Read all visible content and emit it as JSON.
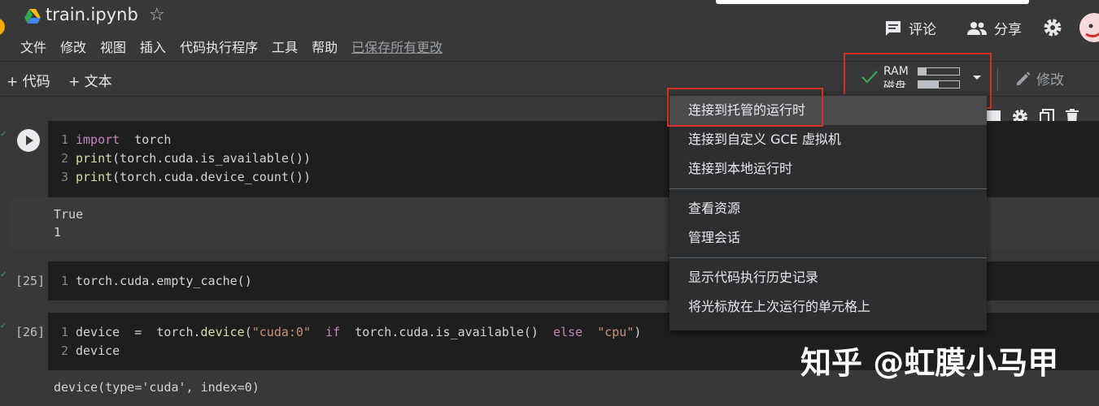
{
  "header": {
    "title": "train.ipynb",
    "menu": [
      "文件",
      "修改",
      "视图",
      "插入",
      "代码执行程序",
      "工具",
      "帮助"
    ],
    "saved_status": "已保存所有更改",
    "comment_label": "评论",
    "share_label": "分享"
  },
  "toolbar": {
    "add_code": "+ 代码",
    "add_text": "+ 文本",
    "ram_label": "RAM",
    "disk_label": "磁盘",
    "ram_usage": 0.2,
    "disk_usage": 0.5,
    "edit_label": "修改"
  },
  "cells": [
    {
      "exec_count": "",
      "lines": [
        {
          "n": "1",
          "a": "import",
          "b": "  torch"
        },
        {
          "n": "2",
          "a": "print",
          "b": "(torch.cuda.is_available())"
        },
        {
          "n": "3",
          "a": "print",
          "b": "(torch.cuda.device_count())"
        }
      ],
      "output": [
        "True",
        "1"
      ]
    },
    {
      "exec_count": "[25]",
      "lines": [
        {
          "n": "1",
          "text": "torch.cuda.empty_cache()"
        }
      ]
    },
    {
      "exec_count": "[26]",
      "line1": {
        "n": "1",
        "p1": "device",
        "p2": "  =  torch.",
        "p3": "device",
        "p4": "(",
        "p5": "\"cuda:0\"",
        "p6": "  if  ",
        "p7": "torch.cuda.is_available()",
        "p8": "  else  ",
        "p9": "\"cpu\"",
        "p10": ")"
      },
      "line2": {
        "n": "2",
        "text": "device"
      },
      "output": [
        "device(type='cuda', index=0)"
      ]
    }
  ],
  "dropdown": {
    "items": [
      "连接到托管的运行时",
      "连接到自定义 GCE 虚拟机",
      "连接到本地运行时",
      "查看资源",
      "管理会话",
      "显示代码执行历史记录",
      "将光标放在上次运行的单元格上"
    ]
  },
  "watermark": "知乎 @虹膜小马甲",
  "colors": {
    "accent_red": "#d93025",
    "check_green": "#34a853",
    "menu_bg": "#2d2e30"
  }
}
